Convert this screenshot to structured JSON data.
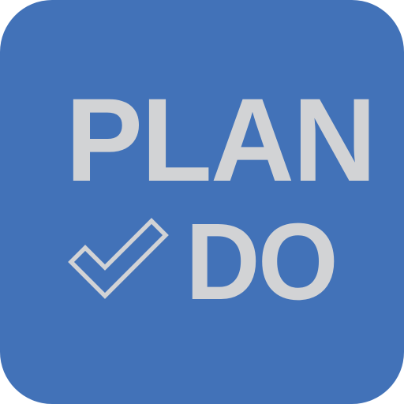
{
  "app_icon": {
    "name": "PLAN DO",
    "background_color": "#4272b8",
    "text_color": "#d2d3d5",
    "line1": "PLAN",
    "line2": "DO",
    "icon": "checkmark-outline-icon"
  }
}
